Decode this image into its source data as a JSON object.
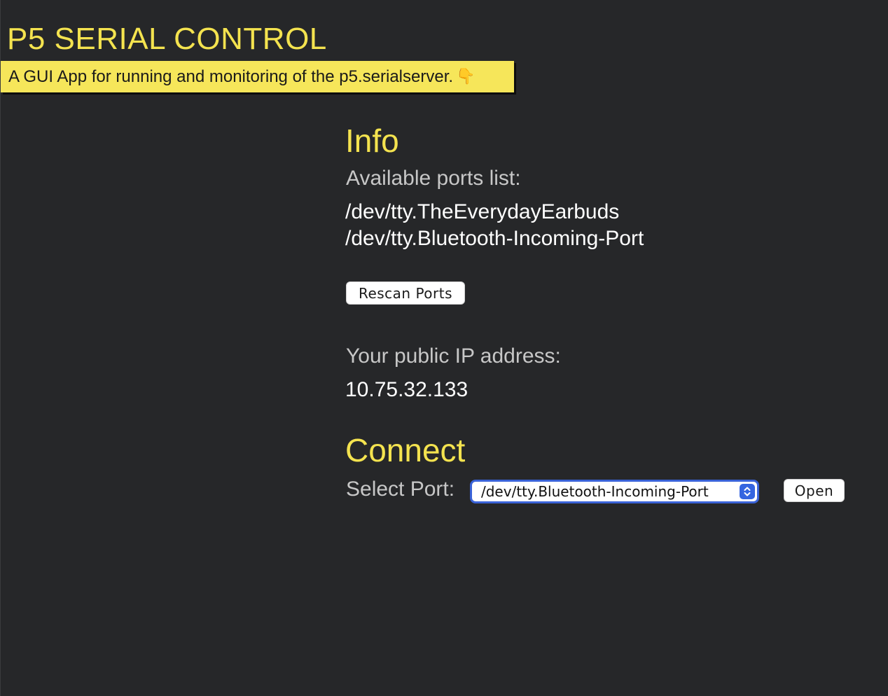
{
  "header": {
    "title": "P5 SERIAL CONTROL",
    "tagline": "A GUI App for running and monitoring of the p5.serialserver.",
    "tagline_icon": "pointing-down-icon"
  },
  "info": {
    "heading": "Info",
    "ports_label": "Available ports list:",
    "ports": [
      "/dev/tty.TheEverydayEarbuds",
      "/dev/tty.Bluetooth-Incoming-Port"
    ],
    "rescan_label": "Rescan Ports",
    "ip_label": "Your public IP address:",
    "ip_value": "10.75.32.133"
  },
  "connect": {
    "heading": "Connect",
    "select_label": "Select Port:",
    "selected_port": "/dev/tty.Bluetooth-Incoming-Port",
    "open_label": "Open"
  },
  "colors": {
    "background": "#262729",
    "accent_yellow": "#f4e34f",
    "select_focus_blue": "#3a63d8"
  }
}
